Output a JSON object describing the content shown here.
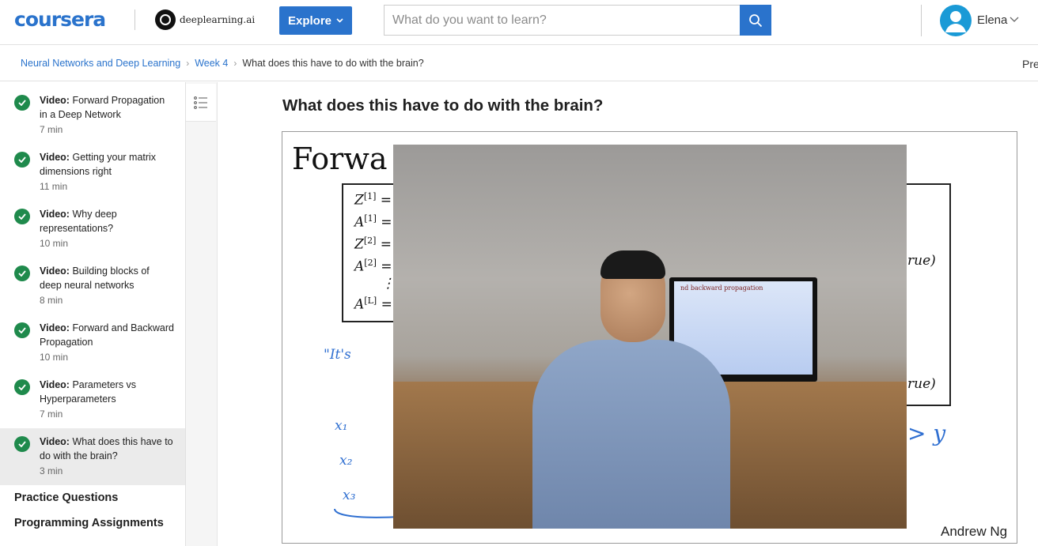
{
  "header": {
    "logo": "coursera",
    "partner_logo": "deeplearning.ai",
    "explore_label": "Explore",
    "search_placeholder": "What do you want to learn?",
    "user_name": "Elena"
  },
  "breadcrumb": {
    "items": [
      "Neural Networks and Deep Learning",
      "Week 4",
      "What does this have to do with the brain?"
    ],
    "prev_label": "Pre"
  },
  "sidebar": {
    "items": [
      {
        "type": "Video:",
        "title": "Forward Propagation in a Deep Network",
        "duration": "7 min",
        "completed": true
      },
      {
        "type": "Video:",
        "title": "Getting your matrix dimensions right",
        "duration": "11 min",
        "completed": true
      },
      {
        "type": "Video:",
        "title": "Why deep representations?",
        "duration": "10 min",
        "completed": true
      },
      {
        "type": "Video:",
        "title": "Building blocks of deep neural networks",
        "duration": "8 min",
        "completed": true
      },
      {
        "type": "Video:",
        "title": "Forward and Backward Propagation",
        "duration": "10 min",
        "completed": true
      },
      {
        "type": "Video:",
        "title": "Parameters vs Hyperparameters",
        "duration": "7 min",
        "completed": true
      },
      {
        "type": "Video:",
        "title": "What does this have to do with the brain?",
        "duration": "3 min",
        "completed": true,
        "active": true
      }
    ],
    "sections": [
      "Practice Questions",
      "Programming Assignments"
    ]
  },
  "main": {
    "title": "What does this have to do with the brain?",
    "video": {
      "slide_title": "Forwa",
      "equations_left": [
        "Z",
        "A",
        "Z",
        "A",
        "A"
      ],
      "equation_superscripts": [
        "[1]",
        "[1]",
        "[2]",
        "[2]",
        "[L]"
      ],
      "equation_right_1": "rue)",
      "equation_right_2": "rue)",
      "handwriting": {
        "quote": "\"It's",
        "x1": "x₁",
        "x2": "x₂",
        "x3": "x₃",
        "y": "> y"
      },
      "screen_text": "nd backward propagation",
      "credit": "Andrew Ng"
    }
  },
  "colors": {
    "brand": "#2a73cc",
    "check": "#1f8a4c",
    "active_bg": "#ebebeb"
  }
}
